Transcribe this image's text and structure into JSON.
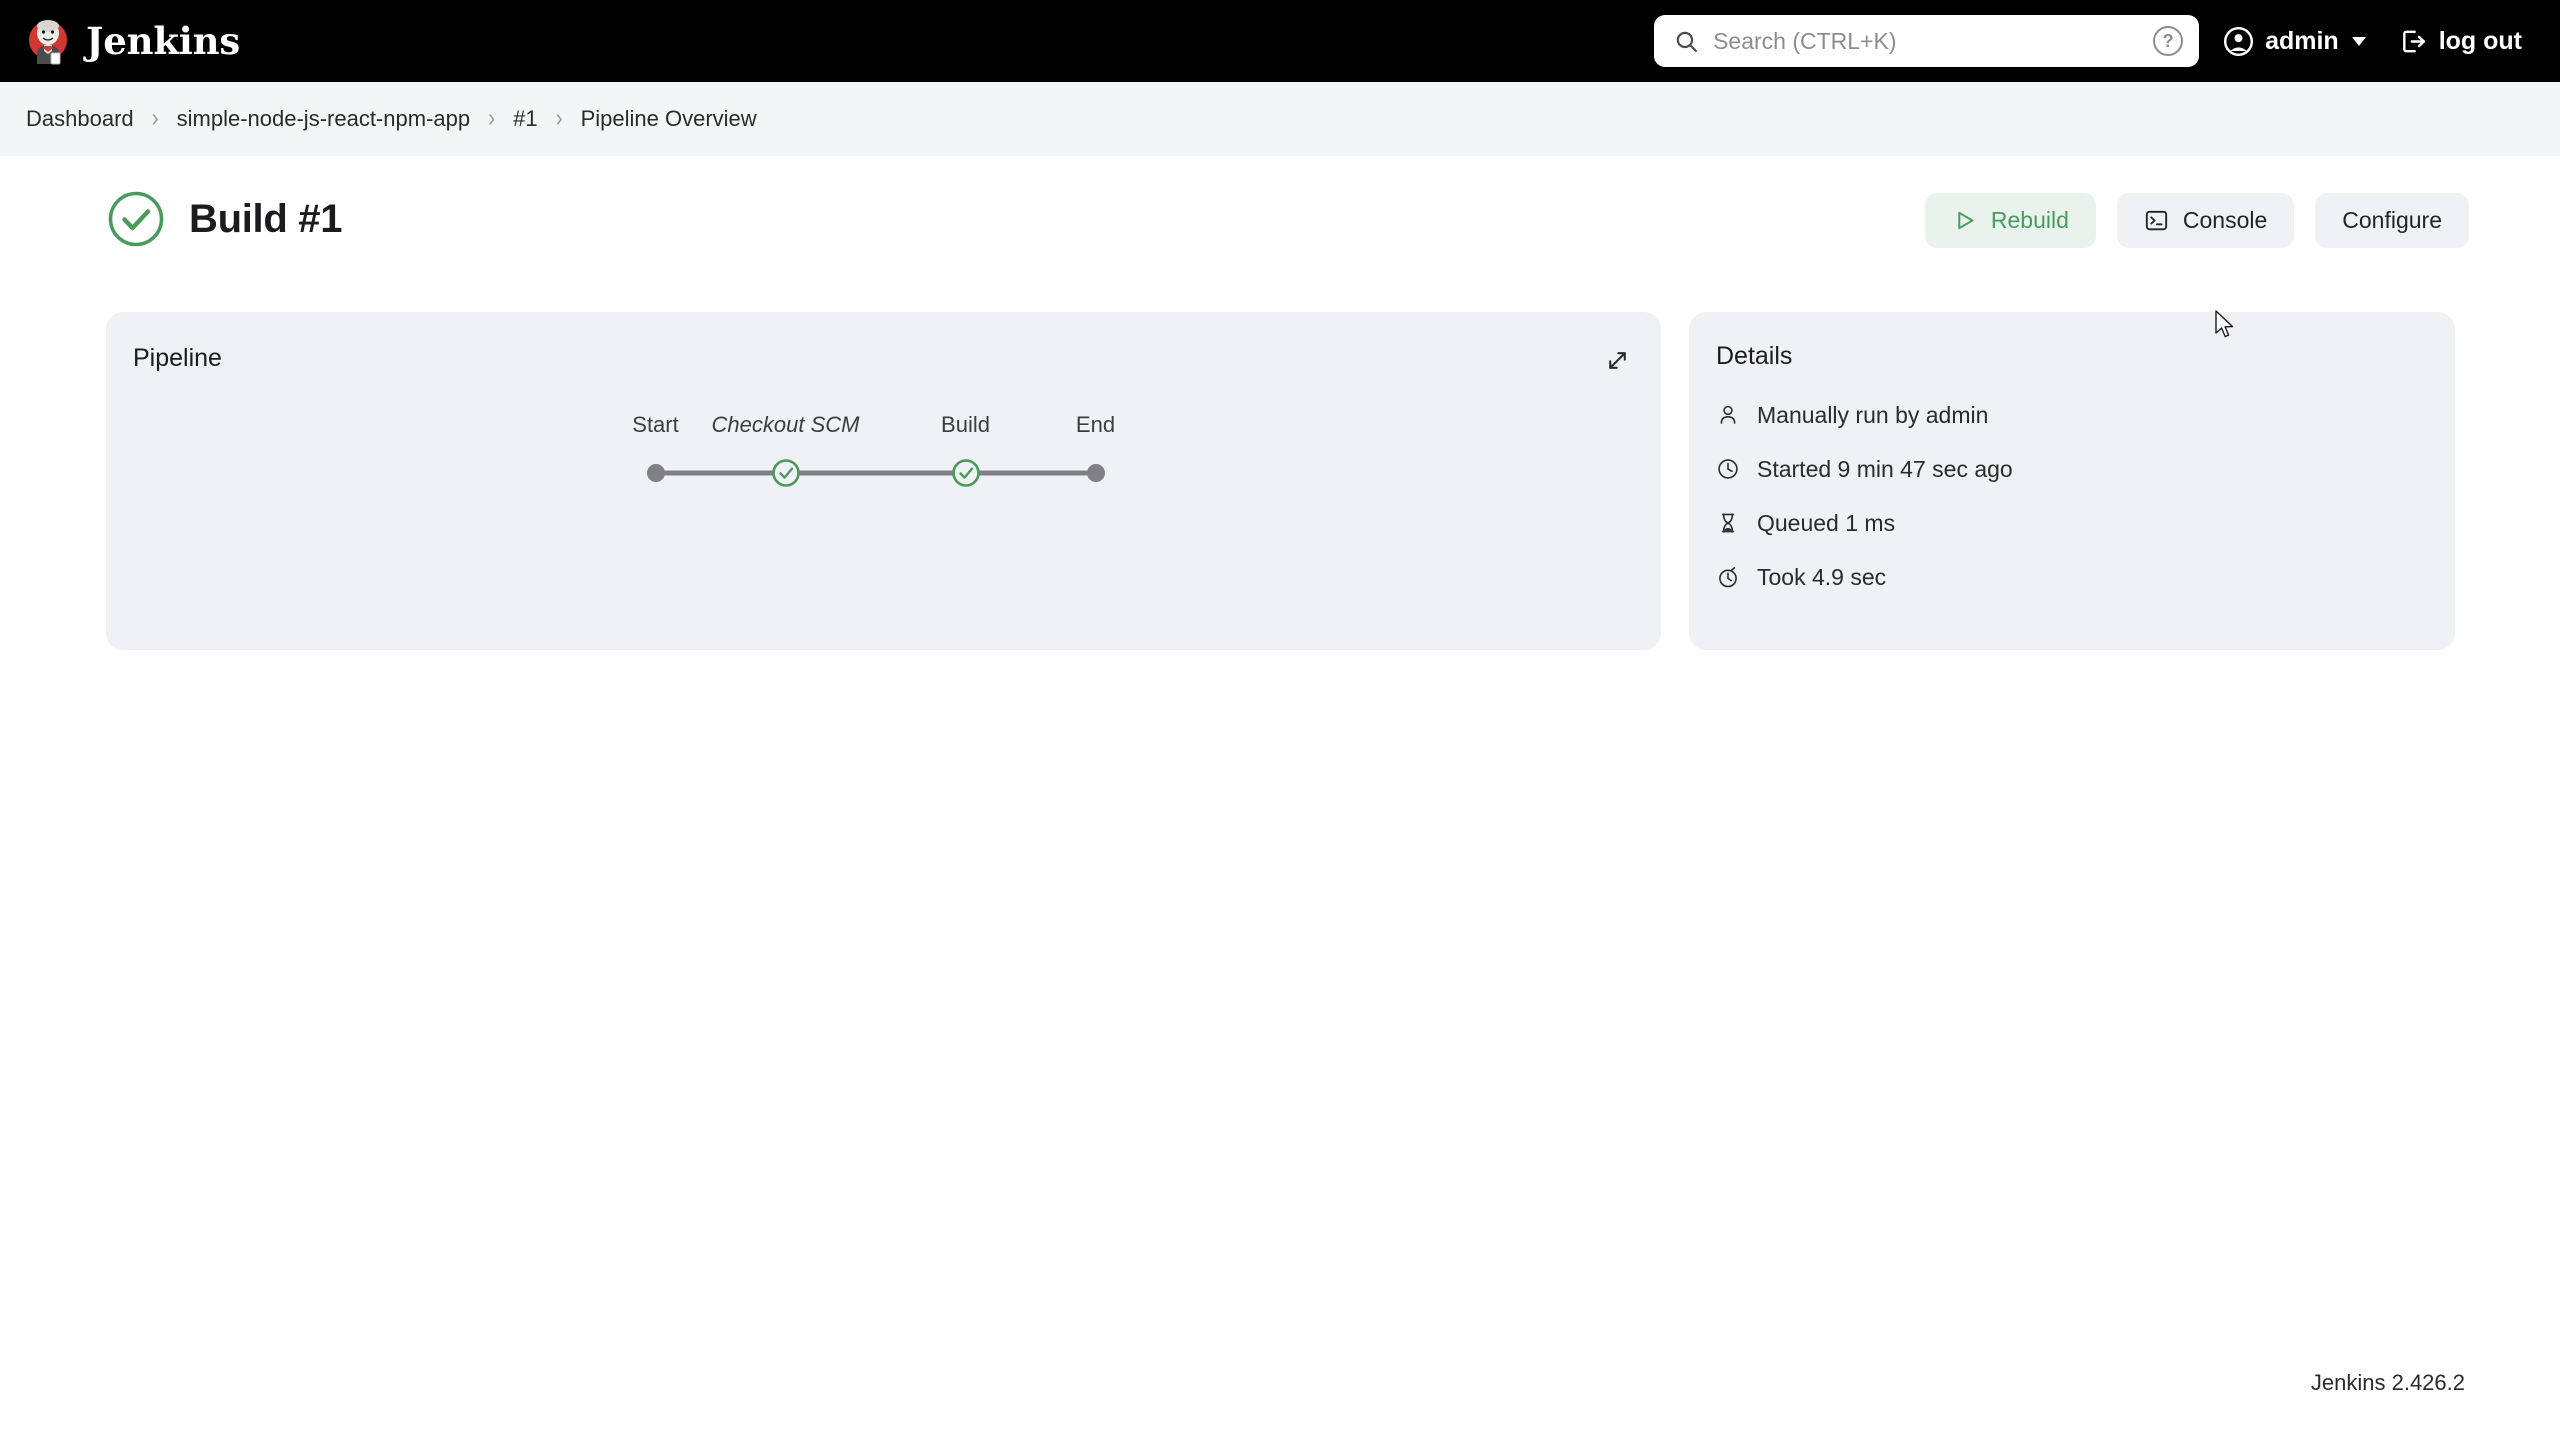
{
  "header": {
    "brand_name": "Jenkins",
    "brand_logo_icon": "jenkins-butler-logo",
    "search": {
      "placeholder": "Search (CTRL+K)",
      "value": "",
      "icon": "search-icon",
      "help_icon": "help-circle-icon",
      "help_label": "?"
    },
    "user": {
      "name": "admin",
      "avatar_icon": "user-circle-icon",
      "chevron_icon": "chevron-down-icon"
    },
    "logout": {
      "label": "log out",
      "icon": "logout-icon"
    }
  },
  "breadcrumb": {
    "separator": "›",
    "items": [
      {
        "label": "Dashboard",
        "link": true
      },
      {
        "label": "simple-node-js-react-npm-app",
        "link": true
      },
      {
        "label": "#1",
        "link": true
      },
      {
        "label": "Pipeline Overview",
        "link": false
      }
    ]
  },
  "page": {
    "title": "Build #1",
    "status_icon": "check-circle-icon",
    "status_color": "#4a9a5e"
  },
  "actions": [
    {
      "label": "Rebuild",
      "icon": "play-triangle-icon",
      "variant": "primary"
    },
    {
      "label": "Console",
      "icon": "terminal-icon",
      "variant": "default"
    },
    {
      "label": "Configure",
      "icon": "",
      "variant": "default"
    }
  ],
  "pipeline_card": {
    "title": "Pipeline",
    "expand_icon": "expand-diagonal-arrows-icon",
    "graph": {
      "start_label": "Start",
      "end_label": "End",
      "nodes": [
        {
          "label": "Start",
          "type": "terminal",
          "status": "neutral",
          "italic": false
        },
        {
          "label": "Checkout SCM",
          "type": "stage",
          "status": "success",
          "italic": true
        },
        {
          "label": "Build",
          "type": "stage",
          "status": "success",
          "italic": false
        },
        {
          "label": "End",
          "type": "terminal",
          "status": "neutral",
          "italic": false
        }
      ],
      "success_color": "#4a9a5e",
      "neutral_color": "#7f7f85",
      "line_color": "#7f7f85"
    }
  },
  "details_card": {
    "title": "Details",
    "rows": [
      {
        "icon": "person-icon",
        "text": "Manually run by admin"
      },
      {
        "icon": "clock-icon",
        "text": "Started 9 min 47 sec ago"
      },
      {
        "icon": "hourglass-icon",
        "text": "Queued 1 ms"
      },
      {
        "icon": "stopwatch-icon",
        "text": "Took 4.9 sec"
      }
    ]
  },
  "footer": {
    "version": "Jenkins 2.426.2"
  },
  "colors": {
    "header_bg": "#000000",
    "breadcrumb_bg": "#f4f5f7",
    "card_bg": "#f0f1f5",
    "page_bg": "#ffffff",
    "accent_green": "#4a9a5e",
    "primary_btn_bg": "#e9f2ec",
    "default_btn_bg": "#f0f1f4"
  }
}
